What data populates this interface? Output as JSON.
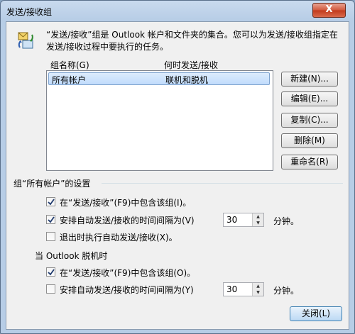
{
  "window": {
    "title": "发送/接收组",
    "close_glyph": "X"
  },
  "intro_text": "“发送/接收”组是 Outlook 帐户和文件夹的集合。您可以为发送/接收组指定在发送/接收过程中要执行的任务。",
  "list": {
    "col_group_name": "组名称(G)",
    "col_when": "何时发送/接收",
    "rows": [
      {
        "name": "所有帐户",
        "when": "联机和脱机"
      }
    ]
  },
  "buttons": {
    "new": "新建(N)...",
    "edit": "编辑(E)...",
    "copy": "复制(C)...",
    "delete": "删除(M)",
    "rename": "重命名(R)",
    "close": "关闭(L)"
  },
  "group_settings_label": "组“所有帐户”的设置",
  "online": {
    "include": {
      "label": "在“发送/接收”(F9)中包含该组(I)。",
      "checked": true
    },
    "schedule": {
      "label": "安排自动发送/接收的时间间隔为(V)",
      "checked": true,
      "minutes": "30",
      "unit": "分钟。"
    },
    "on_exit": {
      "label": "退出时执行自动发送/接收(X)。",
      "checked": false
    }
  },
  "offline_label": "当 Outlook 脱机时",
  "offline": {
    "include": {
      "label": "在“发送/接收”(F9)中包含该组(O)。",
      "checked": true
    },
    "schedule": {
      "label": "安排自动发送/接收的时间间隔为(Y)",
      "checked": false,
      "minutes": "30",
      "unit": "分钟。"
    }
  },
  "colors": {
    "selection": "#c1dcfc",
    "close_red": "#c23a1c",
    "check": "#1f3a6e"
  }
}
